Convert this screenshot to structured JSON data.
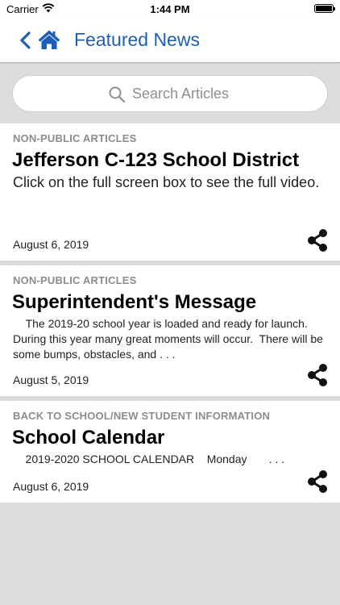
{
  "status_bar": {
    "carrier": "Carrier",
    "time": "1:44 PM"
  },
  "nav": {
    "title": "Featured News"
  },
  "search": {
    "placeholder": "Search Articles"
  },
  "articles": [
    {
      "category": "NON-PUBLIC ARTICLES",
      "title": "Jefferson C-123 School District",
      "summary": "Click on the full screen box to see the full video.",
      "date": "August 6, 2019"
    },
    {
      "category": "NON-PUBLIC ARTICLES",
      "title": "Superintendent's Message",
      "summary": "    The 2019-20 school year is loaded and ready for launch.  During this year many great moments will occur.  There will be some bumps, obstacles, and . . .",
      "date": "August 5, 2019"
    },
    {
      "category": "BACK TO SCHOOL/NEW STUDENT INFORMATION",
      "title": "School Calendar",
      "summary": "    2019-2020 SCHOOL CALENDAR    Monday       . . .",
      "date": "August 6, 2019"
    }
  ],
  "icons": {
    "back": "chevron-left-icon",
    "home": "home-icon",
    "search": "search-icon",
    "share": "share-icon",
    "wifi": "wifi-icon",
    "battery": "battery-icon"
  },
  "colors": {
    "accent": "#1c5fb8",
    "category": "#8c8c8c",
    "background": "#dcdcdc"
  }
}
